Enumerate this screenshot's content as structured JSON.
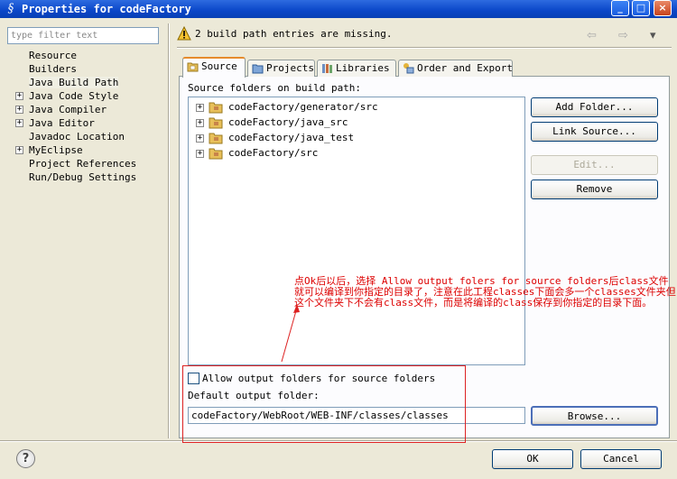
{
  "window": {
    "title": "Properties for codeFactory",
    "icon": "eclipse-properties-icon",
    "controls": {
      "minimize": "_",
      "maximize": "□",
      "close": "×"
    }
  },
  "sidebar": {
    "filter_placeholder": "type filter text",
    "items": [
      {
        "label": "Resource",
        "expandable": false
      },
      {
        "label": "Builders",
        "expandable": false
      },
      {
        "label": "Java Build Path",
        "expandable": false,
        "selected": true
      },
      {
        "label": "Java Code Style",
        "expandable": true
      },
      {
        "label": "Java Compiler",
        "expandable": true
      },
      {
        "label": "Java Editor",
        "expandable": true
      },
      {
        "label": "Javadoc Location",
        "expandable": false
      },
      {
        "label": "MyEclipse",
        "expandable": true
      },
      {
        "label": "Project References",
        "expandable": false
      },
      {
        "label": "Run/Debug Settings",
        "expandable": false
      }
    ]
  },
  "header": {
    "warning_text": "2 build path entries are missing.",
    "back_arrow": "⇦",
    "forward_arrow": "⇨",
    "menu_arrow": "▾"
  },
  "tabs": [
    {
      "label": "Source",
      "icon": "source-folder-icon",
      "active": true
    },
    {
      "label": "Projects",
      "icon": "projects-folder-icon",
      "active": false
    },
    {
      "label": "Libraries",
      "icon": "libraries-icon",
      "active": false
    },
    {
      "label": "Order and Export",
      "icon": "order-export-icon",
      "active": false
    }
  ],
  "source_tab": {
    "folders_label": "Source folders on build path:",
    "folders": [
      "codeFactory/generator/src",
      "codeFactory/java_src",
      "codeFactory/java_test",
      "codeFactory/src"
    ],
    "buttons": {
      "add_folder": "Add Folder...",
      "link_source": "Link Source...",
      "edit": "Edit...",
      "remove": "Remove"
    },
    "allow_output_label": "Allow output folders for source folders",
    "allow_output_checked": false,
    "default_output_label": "Default output folder:",
    "default_output_value": "codeFactory/WebRoot/WEB-INF/classes/classes",
    "browse": "Browse..."
  },
  "annotation": {
    "text": "点Ok后以后，选择 Allow output folers for source folders后class文件就可以编译到你指定的目录了，注意在此工程classes下面会多一个classes文件夹但这个文件夹下不会有class文件，而是将编译的class保存到你指定的目录下面。",
    "color": "#dd0000"
  },
  "footer": {
    "ok": "OK",
    "cancel": "Cancel"
  }
}
